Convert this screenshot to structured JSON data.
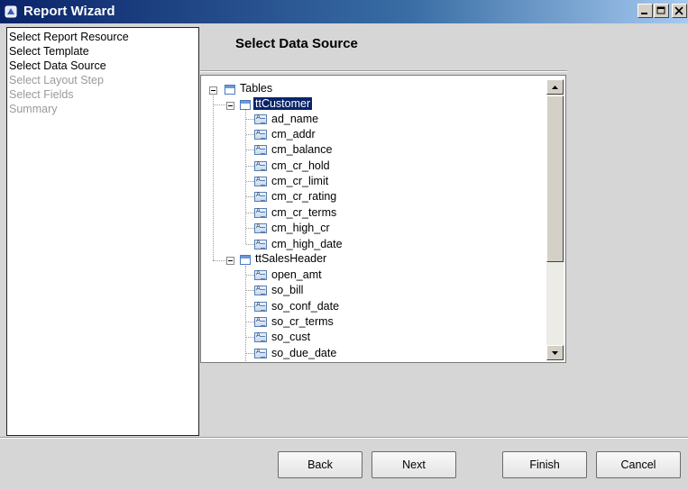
{
  "window": {
    "title": "Report Wizard"
  },
  "steps": [
    {
      "label": "Select Report Resource",
      "enabled": true
    },
    {
      "label": "Select Template",
      "enabled": true
    },
    {
      "label": "Select Data Source",
      "enabled": true
    },
    {
      "label": "Select Layout Step",
      "enabled": false
    },
    {
      "label": "Select Fields",
      "enabled": false
    },
    {
      "label": "Summary",
      "enabled": false
    }
  ],
  "page": {
    "heading": "Select Data Source"
  },
  "tree": {
    "root": "Tables",
    "tables": [
      {
        "name": "ttCustomer",
        "selected": true,
        "fields": [
          "ad_name",
          "cm_addr",
          "cm_balance",
          "cm_cr_hold",
          "cm_cr_limit",
          "cm_cr_rating",
          "cm_cr_terms",
          "cm_high_cr",
          "cm_high_date"
        ]
      },
      {
        "name": "ttSalesHeader",
        "selected": false,
        "fields": [
          "open_amt",
          "so_bill",
          "so_conf_date",
          "so_cr_terms",
          "so_cust",
          "so_due_date"
        ]
      }
    ]
  },
  "buttons": {
    "back": "Back",
    "next": "Next",
    "finish": "Finish",
    "cancel": "Cancel"
  },
  "colors": {
    "selection": "#0a246a",
    "titlebar": "#0a246a",
    "disabled_text": "#9a9a9a"
  }
}
